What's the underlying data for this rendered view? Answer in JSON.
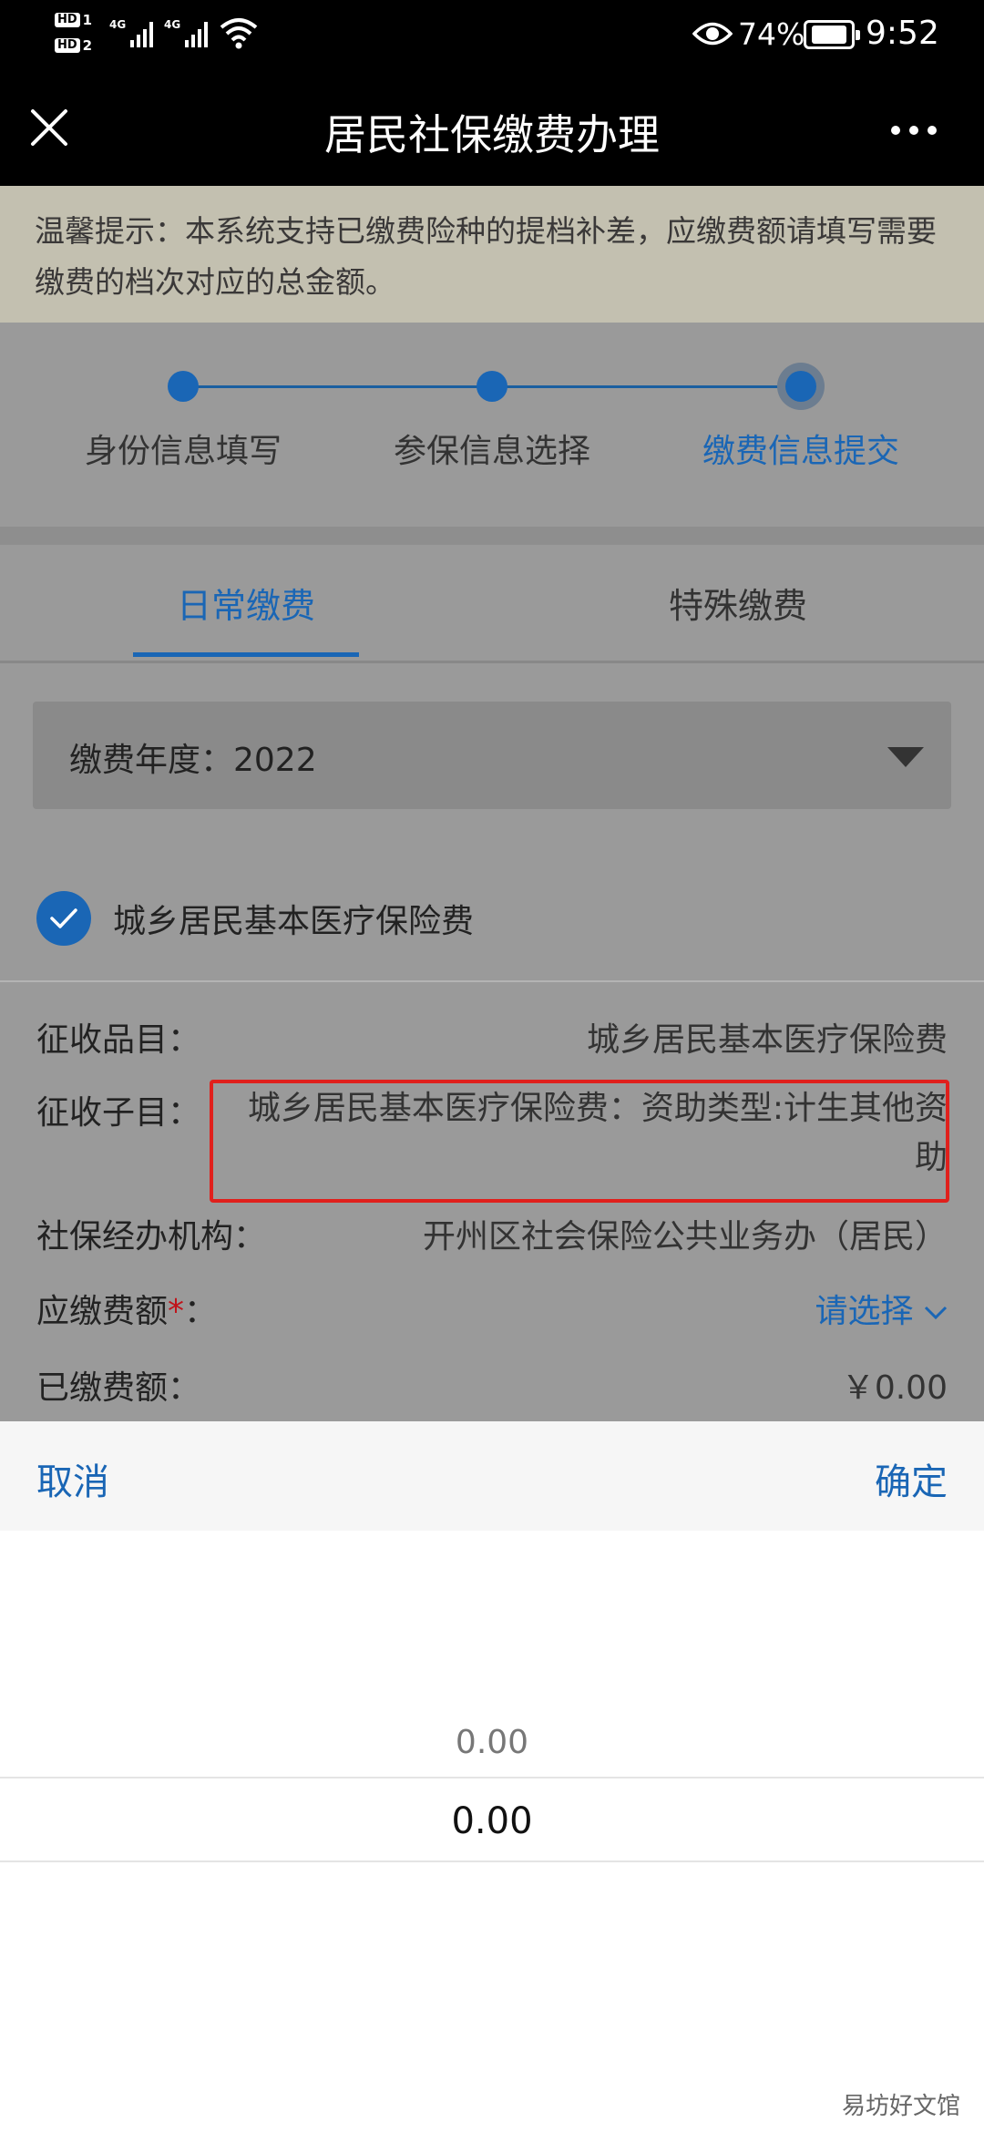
{
  "status_bar": {
    "hd1": "HD",
    "hd1_num": "1",
    "hd2": "HD",
    "hd2_num": "2",
    "net1": "4G",
    "net2": "4G",
    "battery": "74%",
    "time": "9:52"
  },
  "header": {
    "title": "居民社保缴费办理"
  },
  "notice": {
    "text": "温馨提示：本系统支持已缴费险种的提档补差，应缴费额请填写需要缴费的档次对应的总金额。"
  },
  "steps": [
    {
      "label": "身份信息填写"
    },
    {
      "label": "参保信息选择"
    },
    {
      "label": "缴费信息提交"
    }
  ],
  "tabs": [
    {
      "label": "日常缴费"
    },
    {
      "label": "特殊缴费"
    }
  ],
  "form": {
    "year": "缴费年度：2022",
    "insurance_item": "城乡居民基本医疗保险费",
    "rows": [
      {
        "label": "征收品目：",
        "value": "城乡居民基本医疗保险费"
      },
      {
        "label": "征收子目：",
        "value": "城乡居民基本医疗保险费：资助类型:计生其他资助"
      },
      {
        "label": "社保经办机构：",
        "value": "开州区社会保险公共业务办（居民）"
      },
      {
        "label": "应缴费额",
        "required": "*",
        "suffix": "：",
        "value": "请选择"
      },
      {
        "label": "已缴费额：",
        "value": "￥0.00"
      }
    ]
  },
  "picker": {
    "cancel": "取消",
    "confirm": "确定",
    "options": [
      "0.00",
      "0.00"
    ]
  },
  "watermark": "易坊好文馆",
  "colors": {
    "accent": "#1a66b5",
    "required": "#c0141b",
    "highlight": "#e0201c"
  },
  "icons": {
    "close": "close-icon",
    "more": "more-icon",
    "dropdown": "dropdown-triangle-icon",
    "check": "check-icon",
    "chevron": "chevron-down-icon"
  }
}
